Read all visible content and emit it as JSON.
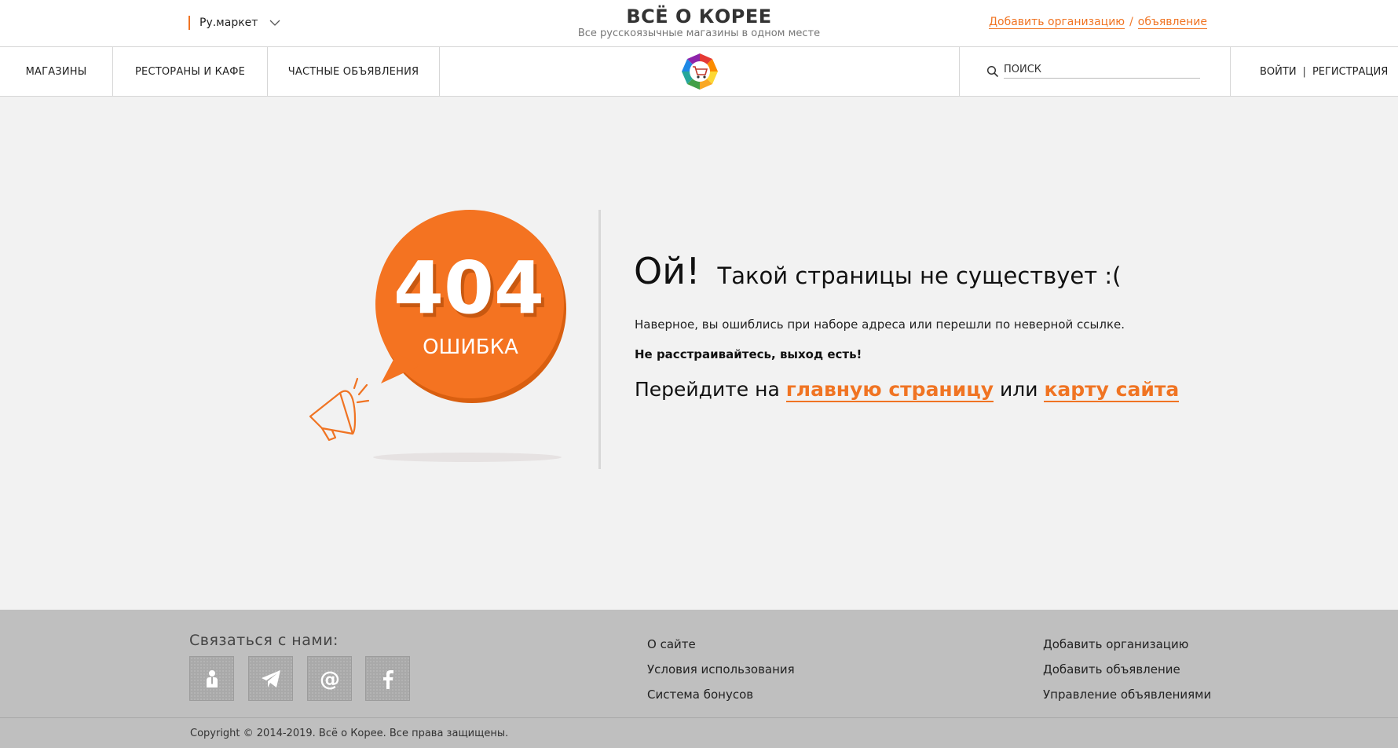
{
  "header": {
    "region": "Ру.маркет",
    "site_title": "ВСЁ О КОРЕЕ",
    "site_subtitle": "Все русскоязычные магазины в одном месте",
    "add_org_prefix": "Добавить",
    "add_org_link": "организацию",
    "add_sep": "/",
    "add_ad_link": "объявление"
  },
  "nav": {
    "items": [
      {
        "label": "Магазины"
      },
      {
        "label": "Рестораны и кафе"
      },
      {
        "label": "Частные объявления"
      }
    ],
    "search_placeholder": "поиск",
    "login": "Войти",
    "auth_sep": "|",
    "register": "Регистрация"
  },
  "error": {
    "code": "404",
    "label": "ОШИБКА",
    "oops": "Ой!",
    "headline": "Такой страницы не существует :(",
    "hint": "Наверное, вы ошиблись при наборе адреса или перешли по неверной ссылке.",
    "calm": "Не расстраивайтесь, выход есть!",
    "goto_prefix": "Перейдите на",
    "home_link": "главную страницу",
    "goto_or": "или",
    "sitemap_link": "карту сайта"
  },
  "footer": {
    "contact_title": "Связаться с нами:",
    "social": [
      "person-icon",
      "telegram-icon",
      "at-icon",
      "facebook-icon"
    ],
    "col1": [
      {
        "label": "О сайте"
      },
      {
        "label": "Условия использования"
      },
      {
        "label": "Система бонусов"
      }
    ],
    "col2": [
      {
        "label": "Добавить организацию"
      },
      {
        "label": "Добавить объявление"
      },
      {
        "label": "Управление объявлениями"
      }
    ],
    "copyright": "Copyright © 2014-2019. Всё о Корее. Все права защищены."
  },
  "colors": {
    "accent": "#f07423",
    "footer_bg": "#bfbfbf",
    "page_bg": "#f2f2f2"
  }
}
